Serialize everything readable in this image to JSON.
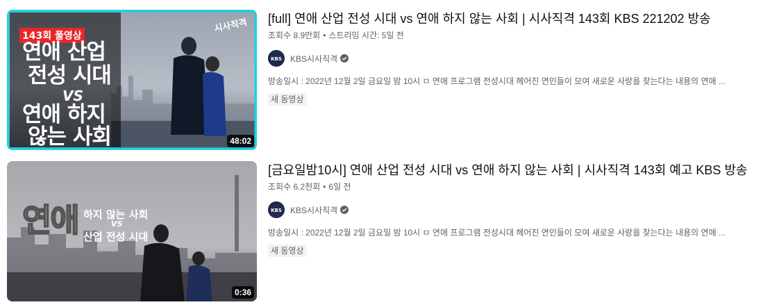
{
  "videos": [
    {
      "title": "[full] 연애 산업 전성 시대 vs 연애 하지 않는 사회 | 시사직격 143회 KBS 221202 방송",
      "views": "조회수 8.9만회",
      "age": "스트리밍 시간: 5일 전",
      "channel": "KBS시사직격",
      "description": "방송일시 : 2022년 12월 2일 금요일 밤 10시 ㅁ 연애 프로그램 전성시대 헤어진 연인들이 모여 새로운 사랑을 찾는다는 내용의 연애 ...",
      "badge": "새 동영상",
      "duration": "48:02",
      "thumb": {
        "tag": "143회 풀영상",
        "line1": "연애 산업",
        "line2": "전성 시대",
        "vs": "VS",
        "line3": "연애 하지",
        "line4": "않는 사회",
        "logo": "시사직격",
        "border_color": "#19d3e6",
        "tag_color": "#e8262a"
      }
    },
    {
      "title": "[금요일밤10시] 연애 산업 전성 시대 vs 연애 하지 않는 사회 | 시사직격 143회 예고 KBS 방송",
      "views": "조회수 6.2천회",
      "age": "6일 전",
      "channel": "KBS시사직격",
      "description": "방송일시 : 2022년 12월 2일 금요일 밤 10시 ㅁ 연애 프로그램 전성시대 헤어진 연인들이 모여 새로운 사랑을 찾는다는 내용의 연애 ...",
      "badge": "새 동영상",
      "duration": "0:36",
      "thumb": {
        "big": "연애",
        "line1": "하지 않는 사회",
        "vs": "VS",
        "line2": "산업 전성 시대"
      }
    }
  ]
}
